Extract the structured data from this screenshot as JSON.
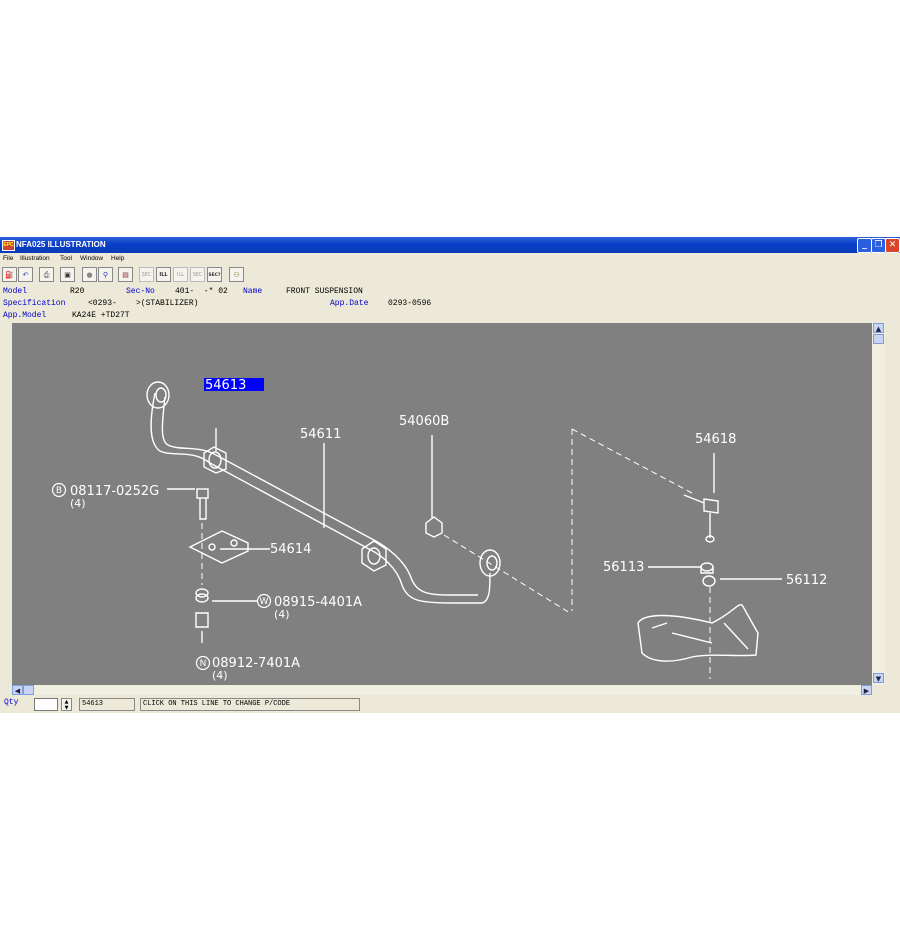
{
  "window": {
    "title": "NFA025  ILLUSTRATION",
    "app_icon": "EPC"
  },
  "menu": [
    "File",
    "Illustration",
    "Tool",
    "Window",
    "Help"
  ],
  "toolbar": {
    "icons": [
      "exit-icon",
      "back-icon",
      "print-icon",
      "screen-icon",
      "circle-icon",
      "search-icon",
      "book-icon",
      "sec-prev-icon",
      "ill-prev-icon",
      "ill-next-icon",
      "sec-next-icon",
      "sec-query-icon",
      "help-icon"
    ],
    "sec_prev": "SEC",
    "ill_prev": "ILL",
    "ill_next": "ILL",
    "sec_next": "SEC",
    "sec_query": "SEC?"
  },
  "info": {
    "model_label": "Model",
    "model": "R20",
    "secno_label": "Sec-No",
    "secno": "401-  -* 02",
    "name_label": "Name",
    "name": "FRONT SUSPENSION",
    "spec_label": "Specification",
    "spec": "<0293-    >(STABILIZER)",
    "appdate_label": "App.Date",
    "appdate": "0293-0596",
    "appmodel_label": "App.Model",
    "appmodel": "KA24E +TD27T"
  },
  "illustration": {
    "selected_part": "54613",
    "callouts": {
      "p54611": "54611",
      "p54060b": "54060B",
      "p54618": "54618",
      "p08117_code": "08117-0252G",
      "p08117_qty": "(4)",
      "p54614": "54614",
      "p56113": "56113",
      "p56112": "56112",
      "p08915_code": "08915-4401A",
      "p08915_qty": "(4)",
      "p08912_code": "08912-7401A",
      "p08912_qty": "(4)",
      "badge_b": "B",
      "badge_w": "W",
      "badge_n": "N"
    }
  },
  "status": {
    "qty_label": "Qty",
    "qty_value": "",
    "part_code": "54613",
    "hint": "CLICK ON THIS LINE TO CHANGE P/CODE"
  },
  "colors": {
    "canvas": "#808080",
    "linework": "#ffffff",
    "selection": "#0000ff",
    "label_blue": "#0000cc"
  }
}
